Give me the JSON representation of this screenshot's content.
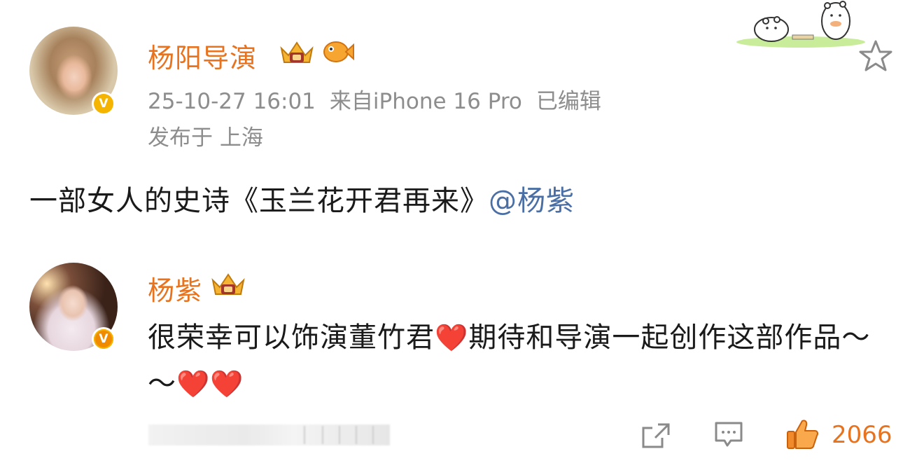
{
  "post": {
    "author": "杨阳导演",
    "time": "25-10-27 16:01",
    "source": "来自iPhone 16 Pro",
    "edited": "已编辑",
    "location": "发布于 上海",
    "text_main": "一部女人的史诗《玉兰花开君再来》",
    "mention": "@杨紫"
  },
  "reply": {
    "author": "杨紫",
    "text_part1": "很荣幸可以饰演董竹君",
    "heart1": "❤️",
    "text_part2": "期待和导演一起创作这部作品～～",
    "heart2": "❤️",
    "heart3": "❤️"
  },
  "actions": {
    "like_count": "2066"
  },
  "icons": {
    "verified": "verified-v-badge",
    "crown": "vip-crown-badge",
    "fish": "fish-badge",
    "star": "favorite-star-icon",
    "share": "share-icon",
    "comment": "comment-icon",
    "like": "thumbs-up-icon"
  },
  "colors": {
    "name": "#e8731f",
    "mention": "#4a6fa5",
    "meta": "#8d8d8d",
    "verified": "#f5b400",
    "heart": "#e3182b",
    "like": "#e8731f"
  }
}
